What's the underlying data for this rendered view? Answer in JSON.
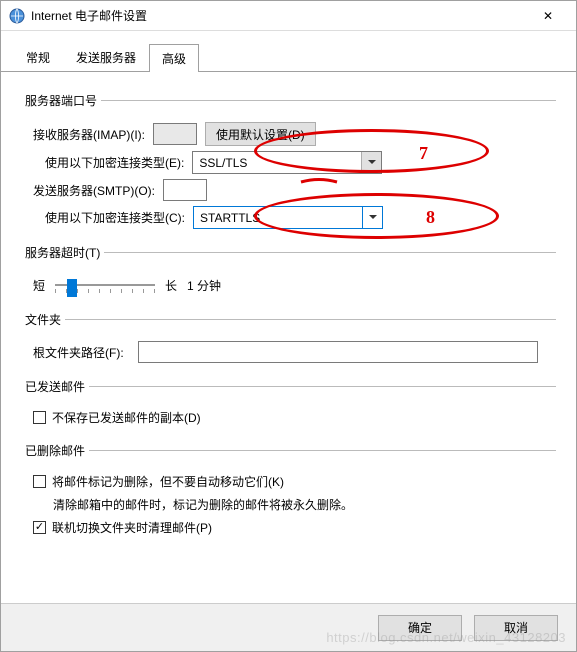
{
  "window": {
    "title": "Internet 电子邮件设置",
    "close": "✕"
  },
  "tabs": {
    "general": "常规",
    "outgoing": "发送服务器",
    "advanced": "高级"
  },
  "server_ports": {
    "legend": "服务器端口号",
    "imap_label": "接收服务器(IMAP)(I):",
    "imap_port": " ",
    "default_btn": "使用默认设置(D)",
    "enc_in_label": "使用以下加密连接类型(E):",
    "enc_in_value": "SSL/TLS",
    "smtp_label": "发送服务器(SMTP)(O):",
    "smtp_port": " ",
    "enc_out_label": "使用以下加密连接类型(C):",
    "enc_out_value": "STARTTLS"
  },
  "timeout": {
    "legend": "服务器超时(T)",
    "short": "短",
    "long": "长",
    "value": "1 分钟"
  },
  "folders": {
    "legend": "文件夹",
    "root_label": "根文件夹路径(F):",
    "root_value": ""
  },
  "sent": {
    "legend": "已发送邮件",
    "no_copy": "不保存已发送邮件的副本(D)"
  },
  "deleted": {
    "legend": "已删除邮件",
    "mark_only": "将邮件标记为删除，但不要自动移动它们(K)",
    "note": "清除邮箱中的邮件时，标记为删除的邮件将被永久删除。",
    "purge": "联机切换文件夹时清理邮件(P)"
  },
  "footer": {
    "ok": "确定",
    "cancel": "取消"
  },
  "annotations": {
    "n7": "7",
    "n8": "8"
  },
  "watermark": "https://blog.csdn.net/weixin_43128203"
}
